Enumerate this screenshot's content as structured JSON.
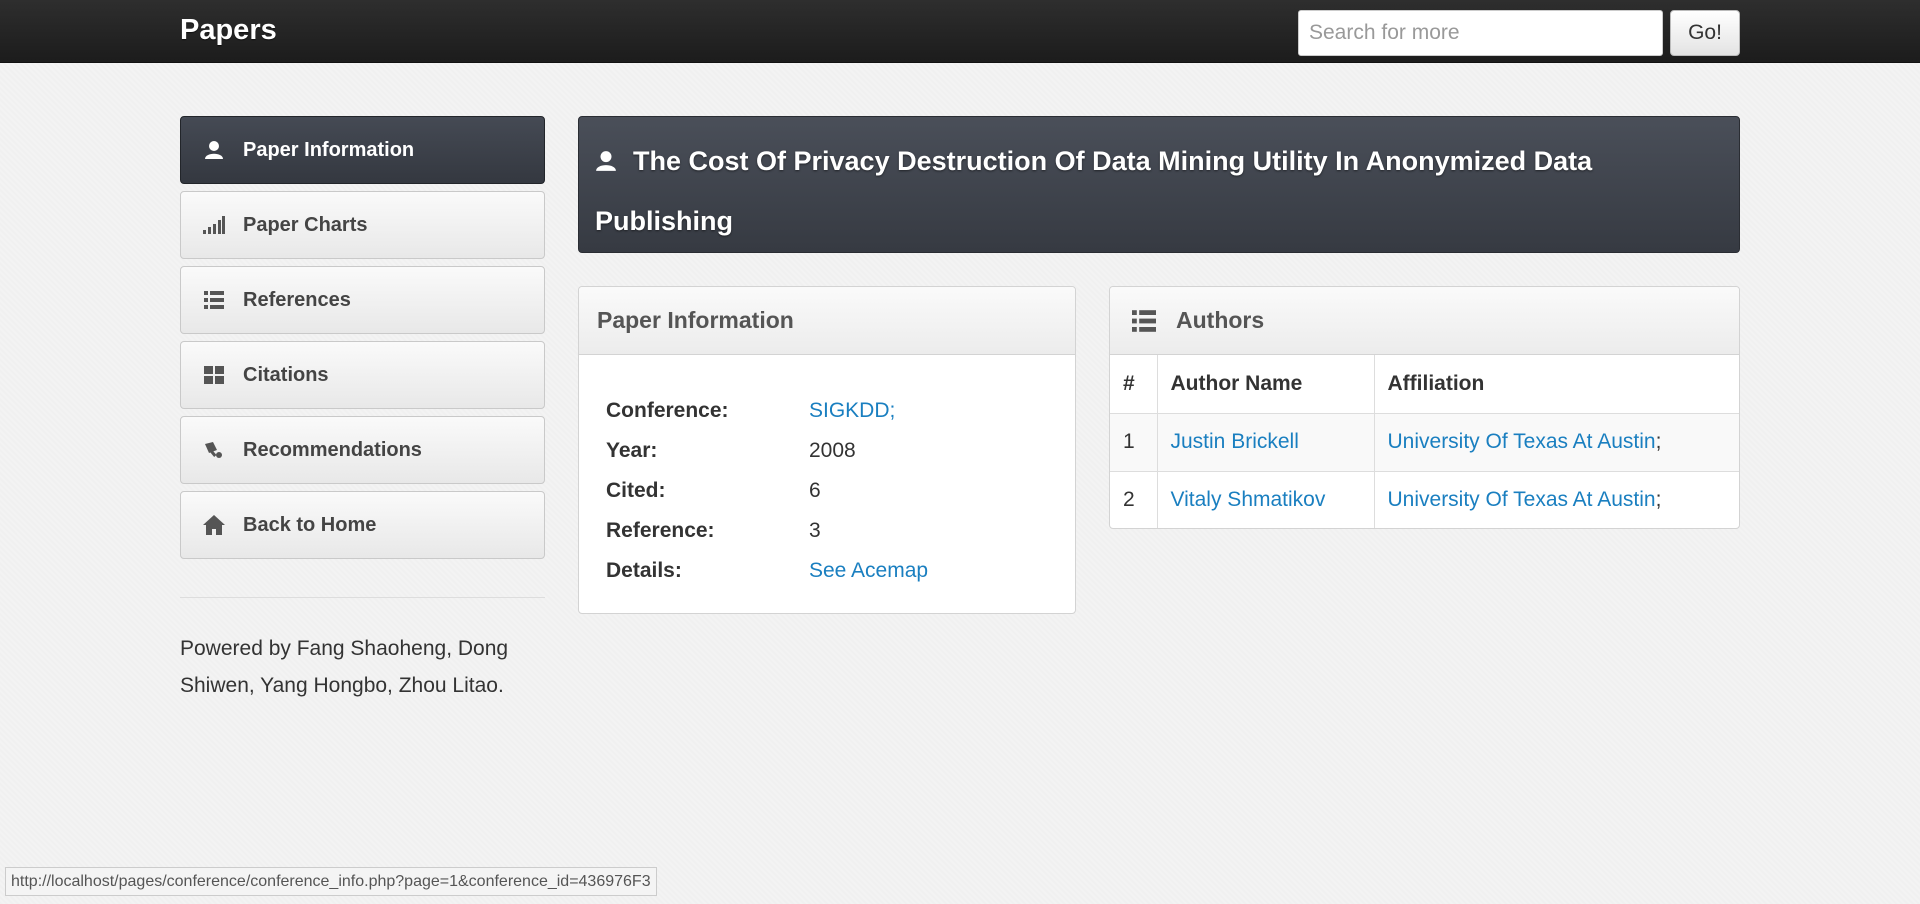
{
  "navbar": {
    "brand": "Papers",
    "search_placeholder": "Search for more",
    "search_button": "Go!"
  },
  "sidebar": {
    "items": [
      {
        "label": "Paper Information",
        "icon": "user-icon",
        "active": true
      },
      {
        "label": "Paper Charts",
        "icon": "signal-icon",
        "active": false
      },
      {
        "label": "References",
        "icon": "list-icon",
        "active": false
      },
      {
        "label": "Citations",
        "icon": "grid-icon",
        "active": false
      },
      {
        "label": "Recommendations",
        "icon": "rss-icon",
        "active": false
      },
      {
        "label": "Back to Home",
        "icon": "home-icon",
        "active": false
      }
    ],
    "powered_by": "Powered by Fang Shaoheng, Dong Shiwen, Yang Hongbo, Zhou Litao."
  },
  "title": {
    "text": "The Cost Of Privacy Destruction Of Data Mining Utility In Anonymized Data Publishing",
    "icon": "user-icon"
  },
  "paper_info": {
    "header": "Paper Information",
    "rows": [
      {
        "label": "Conference:",
        "value": "SIGKDD;",
        "link": true
      },
      {
        "label": "Year:",
        "value": "2008",
        "link": false
      },
      {
        "label": "Cited:",
        "value": "6",
        "link": false
      },
      {
        "label": "Reference:",
        "value": "3",
        "link": false
      },
      {
        "label": "Details:",
        "value": "See Acemap",
        "link": true
      }
    ]
  },
  "authors": {
    "header": "Authors",
    "icon": "list-icon",
    "columns": [
      "#",
      "Author Name",
      "Affiliation"
    ],
    "rows": [
      {
        "num": "1",
        "name": "Justin Brickell",
        "affiliation": "University Of Texas At Austin",
        "sep": ";"
      },
      {
        "num": "2",
        "name": "Vitaly Shmatikov",
        "affiliation": "University Of Texas At Austin",
        "sep": ";"
      }
    ]
  },
  "status_bar": {
    "url": "http://localhost/pages/conference/conference_info.php?page=1&conference_id=436976F3"
  },
  "colors": {
    "link": "#1a7fc0",
    "navbar": "#222222",
    "active_item": "#3d414a"
  }
}
